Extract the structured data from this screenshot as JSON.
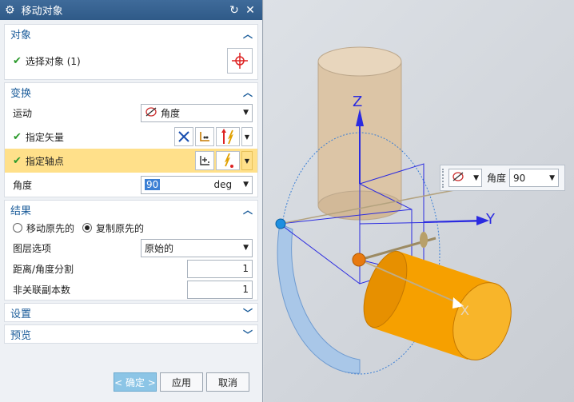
{
  "dialog": {
    "title": "移动对象",
    "sections": {
      "object": {
        "header": "对象",
        "select_label": "选择对象 (1)"
      },
      "transform": {
        "header": "变换",
        "motion_label": "运动",
        "motion_value": "角度",
        "vector_label": "指定矢量",
        "pivot_label": "指定轴点",
        "angle_label": "角度",
        "angle_value": "90",
        "angle_unit": "deg"
      },
      "result": {
        "header": "结果",
        "radio_move": "移动原先的",
        "radio_copy": "复制原先的",
        "layer_label": "图层选项",
        "layer_value": "原始的",
        "split_label": "距离/角度分割",
        "split_value": "1",
        "copies_label": "非关联副本数",
        "copies_value": "1"
      },
      "settings": {
        "header": "设置"
      },
      "preview": {
        "header": "预览"
      }
    },
    "buttons": {
      "ok": "< 确定 >",
      "apply": "应用",
      "cancel": "取消"
    }
  },
  "viewport": {
    "axes": {
      "z": "Z",
      "y": "Y",
      "x": "X"
    },
    "floatbar": {
      "label": "角度",
      "value": "90"
    }
  },
  "colors": {
    "title_bar": "#33608f",
    "section_header": "#1b5c9a",
    "highlight": "#ffe08a",
    "cylinder_orange": "#f6a000",
    "cylinder_tan": "#dcc5a6",
    "axis_blue": "#2b2be0"
  },
  "icons": [
    "gear-icon",
    "reset-icon",
    "close-icon",
    "crosshair-icon",
    "vector-icon",
    "point-icon",
    "rotate-icon"
  ]
}
